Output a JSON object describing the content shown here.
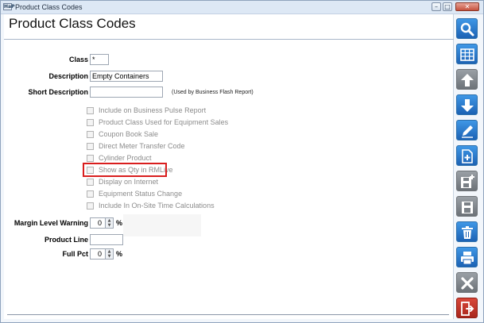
{
  "window": {
    "title": "Product Class Codes",
    "app_badge": "HaP"
  },
  "page": {
    "title": "Product Class Codes"
  },
  "form": {
    "class_label": "Class",
    "class_value": "*",
    "description_label": "Description",
    "description_value": "Empty Containers",
    "short_description_label": "Short Description",
    "short_description_value": "",
    "short_description_note": "(Used by Business Flash Report)",
    "checkboxes": [
      {
        "label": "Include on Business Pulse Report",
        "checked": false
      },
      {
        "label": "Product Class Used for Equipment Sales",
        "checked": false
      },
      {
        "label": "Coupon Book Sale",
        "checked": false
      },
      {
        "label": "Direct Meter Transfer Code",
        "checked": false
      },
      {
        "label": "Cylinder Product",
        "checked": false
      },
      {
        "label": "Show as Qty in RMLive",
        "checked": false,
        "highlighted": true
      },
      {
        "label": "Display on Internet",
        "checked": false
      },
      {
        "label": "Equipment Status Change",
        "checked": false
      },
      {
        "label": "Include In On-Site Time Calculations",
        "checked": false
      }
    ],
    "margin_label": "Margin Level Warning",
    "margin_value": "0",
    "margin_unit": "%",
    "product_line_label": "Product Line",
    "product_line_value": "",
    "full_pct_label": "Full Pct",
    "full_pct_value": "0",
    "full_pct_unit": "%"
  },
  "toolbar": {
    "buttons": [
      {
        "icon": "search-icon",
        "color": "blue"
      },
      {
        "icon": "grid-icon",
        "color": "blue"
      },
      {
        "icon": "arrow-up-icon",
        "color": "gray"
      },
      {
        "icon": "arrow-down-icon",
        "color": "blue"
      },
      {
        "icon": "edit-icon",
        "color": "blue"
      },
      {
        "icon": "new-document-icon",
        "color": "blue"
      },
      {
        "icon": "save-new-icon",
        "color": "gray"
      },
      {
        "icon": "save-icon",
        "color": "gray"
      },
      {
        "icon": "delete-icon",
        "color": "blue"
      },
      {
        "icon": "print-icon",
        "color": "blue"
      },
      {
        "icon": "cancel-icon",
        "color": "gray"
      },
      {
        "icon": "exit-icon",
        "color": "red"
      }
    ]
  },
  "colors": {
    "accent": "#1c62b4",
    "highlight": "#d91e1e",
    "exit": "#a8261c"
  }
}
